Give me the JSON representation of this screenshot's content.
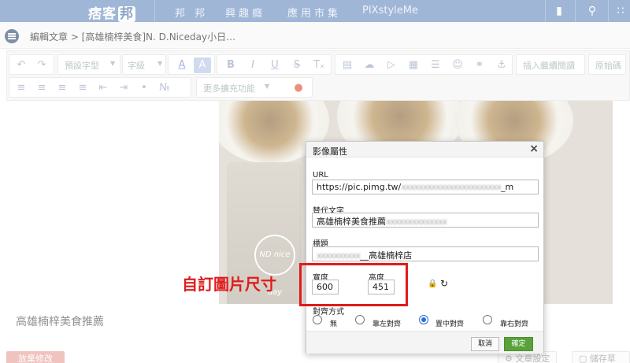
{
  "topbar": {
    "logo": "痞客",
    "logo_badge": "邦",
    "nav": [
      "邦 邦",
      "興趣癮",
      "應用市集",
      "PIXstyleMe"
    ]
  },
  "breadcrumb": "編輯文章 > [高雄楠梓美食]N. D.Niceday小日…",
  "toolbar": {
    "font_face": "預設字型",
    "font_size": "字級",
    "insert_more": "插入繼續閱讀",
    "source": "原始碼",
    "more_features": "更多擴充功能"
  },
  "photo": {
    "cup_logo": "ND nice day"
  },
  "editor": {
    "body_text": "高雄楠梓美食推薦",
    "discard": "放棄修改",
    "article_settings": "文章設定",
    "save_draft": "儲存草稿"
  },
  "dialog": {
    "title": "影像屬性",
    "url_label": "URL",
    "url_value_start": "https://pic.pimg.tw/",
    "url_value_end": "_m",
    "alt_label": "替代文字",
    "alt_value": "高雄楠梓美食推薦",
    "title_label": "標題",
    "title_value": "__高雄楠梓店",
    "width_label": "寬度",
    "width_value": "600",
    "height_label": "高度",
    "height_value": "451",
    "align_label": "對齊方式",
    "align_options": [
      "無",
      "靠左對齊",
      "置中對齊",
      "靠右對齊"
    ],
    "align_selected": "置中對齊",
    "cancel": "取消",
    "ok": "確定"
  },
  "annotation": "自訂圖片尺寸",
  "colors": {
    "topbar": "#9fb6d6",
    "accent_red": "#e01b1b",
    "ok_green": "#58a23b",
    "radio_blue": "#2b6fd3"
  }
}
